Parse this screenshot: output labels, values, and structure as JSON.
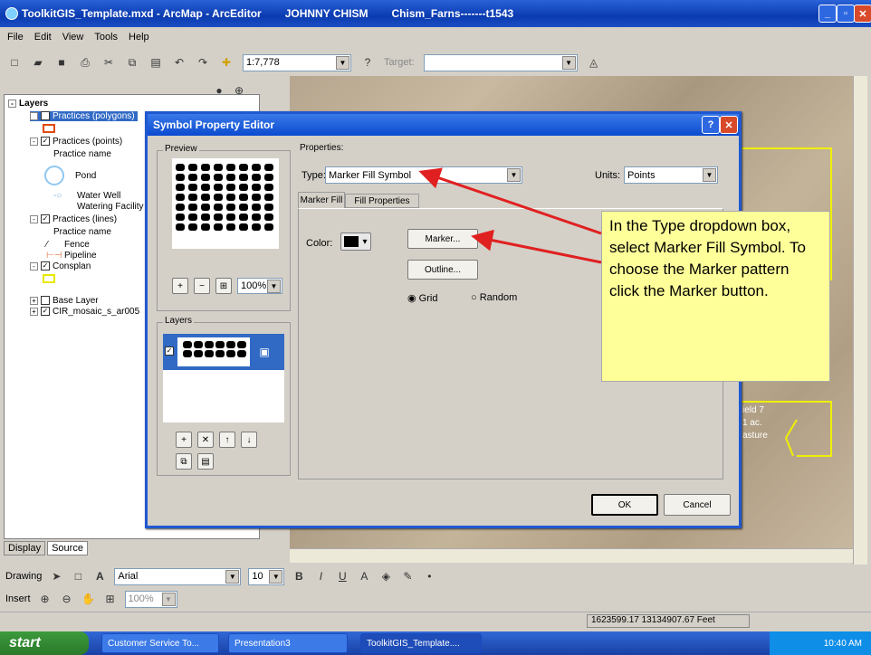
{
  "app": {
    "title": "ToolkitGIS_Template.mxd - ArcMap - ArcEditor",
    "user": "JOHNNY CHISM",
    "farm": "Chism_Farns-------t1543"
  },
  "menu": [
    "File",
    "Edit",
    "View",
    "Tools",
    "Help"
  ],
  "toolbar": {
    "scale": "1:7,778",
    "target_label": "Target:"
  },
  "toc": {
    "layers_title": "Layers",
    "items": [
      {
        "label": "Practices (polygons)"
      },
      {
        "label": "Practices (points)"
      },
      {
        "label": "Practice name"
      },
      {
        "label": "Pond"
      },
      {
        "label": "Water Well"
      },
      {
        "label": "Watering Facility"
      },
      {
        "label": "Practices (lines)"
      },
      {
        "label": "Practice name"
      },
      {
        "label": "Fence"
      },
      {
        "label": "Pipeline"
      },
      {
        "label": "Consplan"
      },
      {
        "label": "Base Layer"
      },
      {
        "label": "CIR_mosaic_s_ar005"
      }
    ],
    "tab_display": "Display",
    "tab_source": "Source"
  },
  "dialog": {
    "title": "Symbol Property Editor",
    "preview_label": "Preview",
    "properties_label": "Properties:",
    "type_label": "Type:",
    "type_value": "Marker Fill Symbol",
    "units_label": "Units:",
    "units_value": "Points",
    "tab_marker_fill": "Marker Fill",
    "tab_fill_properties": "Fill Properties",
    "color_label": "Color:",
    "marker_button": "Marker...",
    "outline_button": "Outline...",
    "grid_label": "Grid",
    "random_label": "Random",
    "zoom_value": "100%",
    "layers_label": "Layers",
    "ok_button": "OK",
    "cancel_button": "Cancel"
  },
  "callout": {
    "text": "In the Type dropdown box, select Marker Fill Symbol. To choose the Marker pattern click the Marker button."
  },
  "map_labels": [
    "ield 7",
    "1 ac.",
    "asture"
  ],
  "bottom_toolbar": {
    "drawing": "Drawing",
    "font_name": "Arial",
    "font_size": "10",
    "insert": "Insert",
    "zoom": "100%"
  },
  "status": {
    "coords": "1623599.17  13134907.67 Feet"
  },
  "taskbar": {
    "start": "start",
    "tasks": [
      "Customer Service To...",
      "Presentation3",
      "ToolkitGIS_Template...."
    ],
    "time": "10:40 AM"
  },
  "colors": {
    "callout_bg": "#ffff99",
    "arrow": "#e02020",
    "title_blue": "#0a3ab0"
  }
}
